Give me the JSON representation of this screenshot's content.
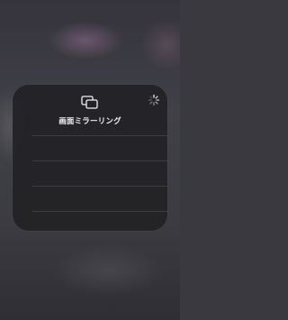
{
  "screen_mirroring": {
    "title": "画面ミラーリング",
    "icon": "screen-mirroring-icon",
    "status_icon": "loading-spinner-icon",
    "device_rows": [
      "",
      "",
      "",
      ""
    ]
  },
  "colors": {
    "panel_background": "#222226",
    "text": "#f2f2f4",
    "separator": "#48484c"
  }
}
